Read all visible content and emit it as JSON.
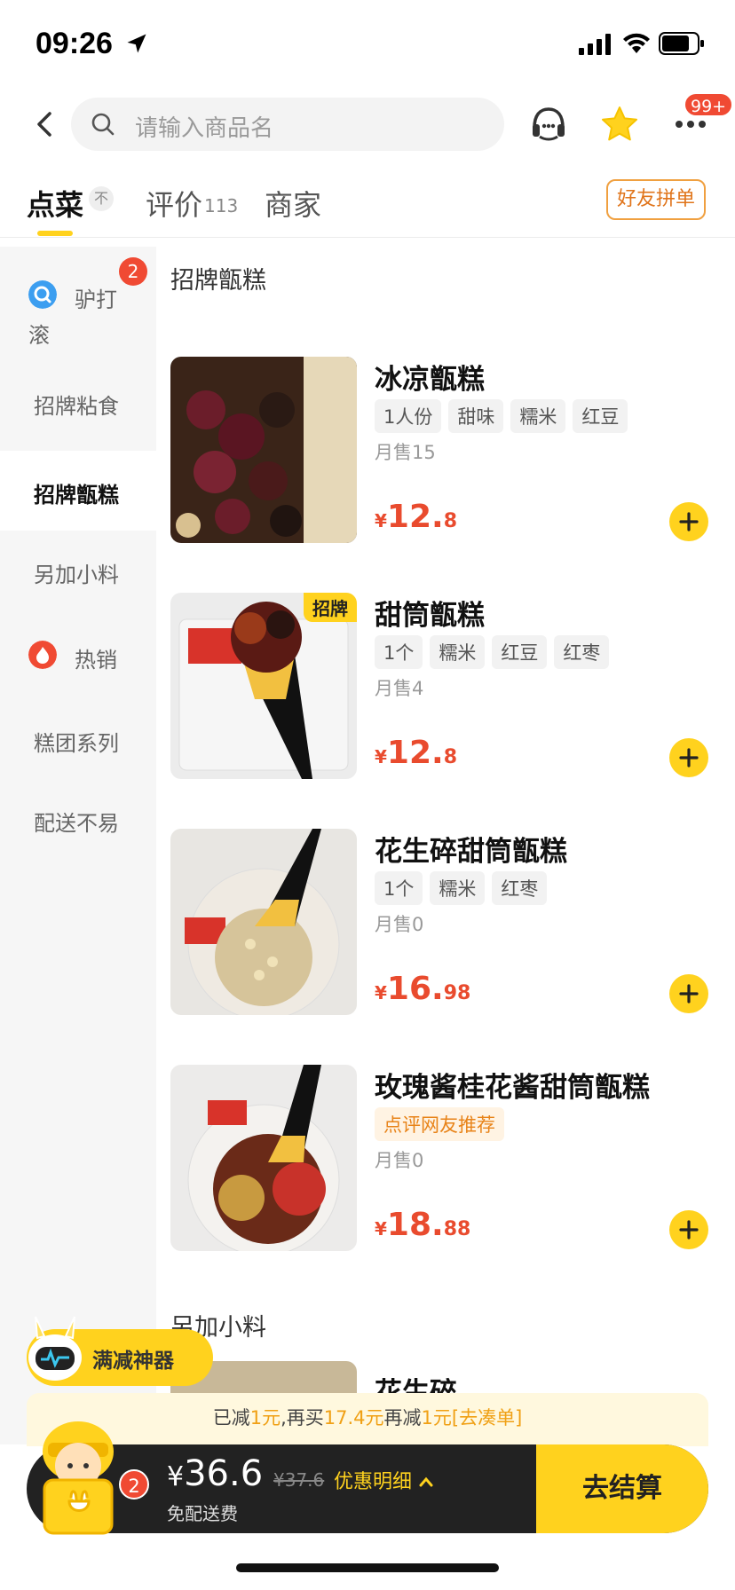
{
  "status": {
    "time": "09:26"
  },
  "search": {
    "placeholder": "请输入商品名"
  },
  "header": {
    "more_badge": "99+"
  },
  "tabs": {
    "order": "点菜",
    "order_pin": "不",
    "review": "评价",
    "review_count": "113",
    "merchant": "商家",
    "friend_button": "好友拼单"
  },
  "sidebar": {
    "items": [
      {
        "label": "驴打滚",
        "badge": "2",
        "icon": "search-icon"
      },
      {
        "label": "招牌粘食"
      },
      {
        "label": "招牌甑糕",
        "active": true
      },
      {
        "label": "另加小料"
      },
      {
        "label": "热销",
        "icon": "fire-icon"
      },
      {
        "label": "糕团系列"
      },
      {
        "label": "配送不易"
      }
    ]
  },
  "sections": [
    {
      "title": "招牌甑糕",
      "items": [
        {
          "name": "冰凉甑糕",
          "tags": [
            "1人份",
            "甜味",
            "糯米",
            "红豆"
          ],
          "sold": "月售15",
          "currency": "¥",
          "price_int": "12.",
          "price_dec": "8"
        },
        {
          "name": "甜筒甑糕",
          "badge": "招牌",
          "tags": [
            "1个",
            "糯米",
            "红豆",
            "红枣"
          ],
          "sold": "月售4",
          "currency": "¥",
          "price_int": "12.",
          "price_dec": "8"
        },
        {
          "name": "花生碎甜筒甑糕",
          "tags": [
            "1个",
            "糯米",
            "红枣"
          ],
          "sold": "月售0",
          "currency": "¥",
          "price_int": "16.",
          "price_dec": "98"
        },
        {
          "name": "玫瑰酱桂花酱甜筒甑糕",
          "recommend_tag": "点评网友推荐",
          "sold": "月售0",
          "currency": "¥",
          "price_int": "18.",
          "price_dec": "88"
        }
      ]
    },
    {
      "title": "另加小料",
      "items": [
        {
          "name": "花生碎"
        }
      ]
    }
  ],
  "promo": {
    "label": "满减神器"
  },
  "discount": {
    "p1": "已减",
    "v1": "1元",
    "p2": ",再买",
    "v2": "17.4元",
    "p3": "再减",
    "v3": "1元",
    "link": "[去凑单]"
  },
  "cart": {
    "badge": "2",
    "currency": "¥",
    "total": "36.6",
    "original": "¥37.6",
    "detail": "优惠明细",
    "fee": "免配送费",
    "checkout": "去结算"
  },
  "colors": {
    "accent": "#ffd21e",
    "price": "#e94b2e",
    "badge": "#f04a33"
  }
}
